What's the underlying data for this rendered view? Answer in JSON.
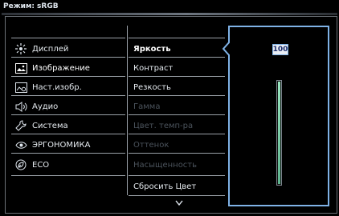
{
  "header": {
    "title": "Режим: sRGB"
  },
  "menu": [
    {
      "label": "Дисплей",
      "icon": "display-icon",
      "active": false
    },
    {
      "label": "Изображение",
      "icon": "image-icon",
      "active": true
    },
    {
      "label": "Наст.изобр.",
      "icon": "image-settings-icon",
      "active": false
    },
    {
      "label": "Аудио",
      "icon": "speaker-icon",
      "active": false
    },
    {
      "label": "Система",
      "icon": "wrench-icon",
      "active": false
    },
    {
      "label": "ЭРГОНОМИКА",
      "icon": "eye-icon",
      "active": false
    },
    {
      "label": "ECO",
      "icon": "leaf-icon",
      "active": false
    }
  ],
  "submenu": [
    {
      "label": "Яркость",
      "state": "active"
    },
    {
      "label": "Контраст",
      "state": "normal"
    },
    {
      "label": "Резкость",
      "state": "normal"
    },
    {
      "label": "Гамма",
      "state": "disabled"
    },
    {
      "label": "Цвет. темп-ра",
      "state": "disabled"
    },
    {
      "label": "Оттенок",
      "state": "disabled"
    },
    {
      "label": "Насыщенность",
      "state": "disabled"
    },
    {
      "label": "Сбросить Цвет",
      "state": "normal"
    }
  ],
  "brightness": {
    "value": "100",
    "level": 1.0
  },
  "colors": {
    "accent": "#7fb2e6",
    "slider_fill": "#7fd3a8",
    "disabled_text": "#4b535c"
  }
}
